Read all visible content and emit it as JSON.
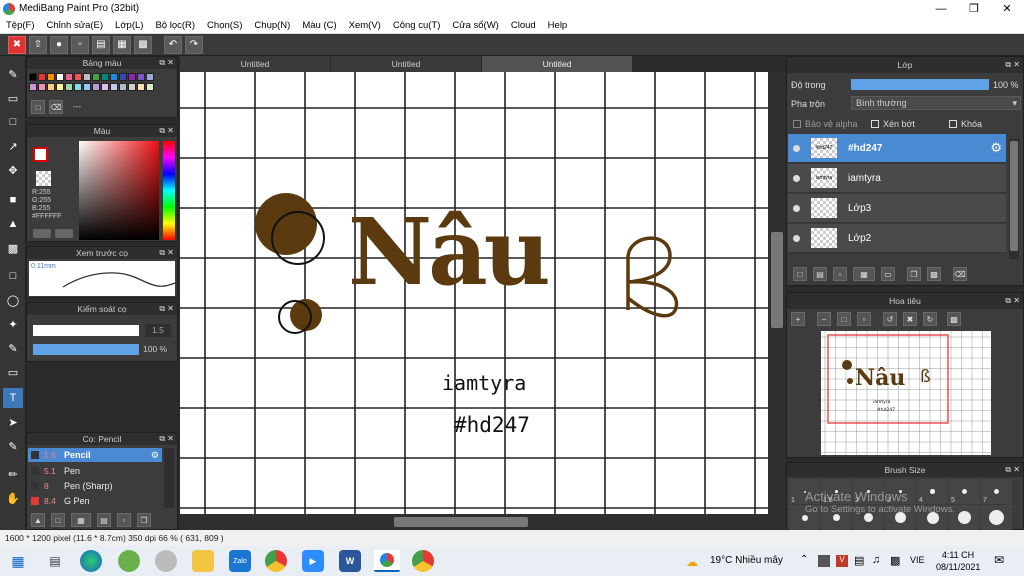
{
  "window": {
    "title": "MediBang Paint Pro (32bit)"
  },
  "menu": [
    "Tệp(F)",
    "Chỉnh sửa(E)",
    "Lớp(L)",
    "Bộ lọc(R)",
    "Chọn(S)",
    "Chụp(N)",
    "Màu (C)",
    "Xem(V)",
    "Công cụ(T)",
    "Cửa sổ(W)",
    "Cloud",
    "Help"
  ],
  "tabs": [
    "Untitled",
    "Untitled",
    "Untitled"
  ],
  "panels": {
    "palette": {
      "title": "Bảng màu",
      "extra": "---"
    },
    "color": {
      "title": "Màu",
      "r": "R:255",
      "g": "G:255",
      "b": "B:255",
      "hex": "#FFFFFF"
    },
    "brush_preview": {
      "title": "Xem trước cọ",
      "size_text": "0.11mm"
    },
    "brush_control": {
      "title": "Kiểm soát cọ",
      "size": "1.5",
      "opacity": "100 %"
    },
    "brush": {
      "title": "Cọ: Pencil",
      "items": [
        {
          "size": "1.5",
          "name": "Pencil"
        },
        {
          "size": "5.1",
          "name": "Pen"
        },
        {
          "size": "8",
          "name": "Pen (Sharp)"
        },
        {
          "size": "8.4",
          "name": "G Pen"
        }
      ]
    },
    "layers": {
      "title": "Lớp",
      "opacity_label": "Độ trong",
      "opacity_value": "100 %",
      "blend_label": "Pha trộn",
      "blend_value": "Bình thường",
      "protect_alpha": "Bảo vệ alpha",
      "clipping": "Xén bớt",
      "lock": "Khóa",
      "items": [
        {
          "name": "#hd247",
          "thumb": "#hd247"
        },
        {
          "name": "iamtyra",
          "thumb": "iamtyra"
        },
        {
          "name": "Lớp3",
          "thumb": ""
        },
        {
          "name": "Lớp2",
          "thumb": ""
        }
      ]
    },
    "navigator": {
      "title": "Hoa tiêu"
    },
    "brush_size": {
      "title": "Brush Size",
      "sizes": [
        "1",
        "1.5",
        "2",
        "3",
        "4",
        "5",
        "7"
      ]
    }
  },
  "canvas_text": {
    "main": "Nâu",
    "line1": "iamtyra",
    "line2": "#hd247"
  },
  "status": {
    "text": "1600 * 1200 pixel   (11.6 * 8.7cm)   350 dpi   66 %   ( 631, 809 )"
  },
  "watermark": {
    "line1": "Activate Windows",
    "line2": "Go to Settings to activate Windows."
  },
  "taskbar": {
    "weather": "19°C  Nhiều mây",
    "lang": "VIE",
    "time": "4:11 CH",
    "date": "08/11/2021"
  },
  "colors": {
    "accent": "#4a8ad2",
    "brown": "#5a3a0e",
    "selected_brush": "#4a8ad2"
  }
}
